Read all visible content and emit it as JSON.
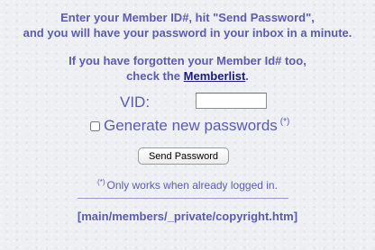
{
  "intro": {
    "line1": "Enter your Member ID#, hit \"Send Password\",",
    "line2": "and you will have your password in your inbox in a minute."
  },
  "forgot": {
    "line1": "If you have forgotten your Member Id# too,",
    "line2_prefix": "check the ",
    "link_label": "Memberlist",
    "line2_suffix": "."
  },
  "form": {
    "vid_label": "VID:",
    "vid_value": "",
    "generate_label": "Generate new passwords",
    "generate_marker": "(*)",
    "generate_checked": false,
    "send_button_label": "Send Password"
  },
  "note": {
    "marker": "(*)",
    "text": "Only works when already logged in."
  },
  "footer_path": "[main/members/_private/copyright.htm]",
  "colors": {
    "text": "#5b5bb0",
    "link": "#1a1a80",
    "background": "#eeeff3"
  }
}
